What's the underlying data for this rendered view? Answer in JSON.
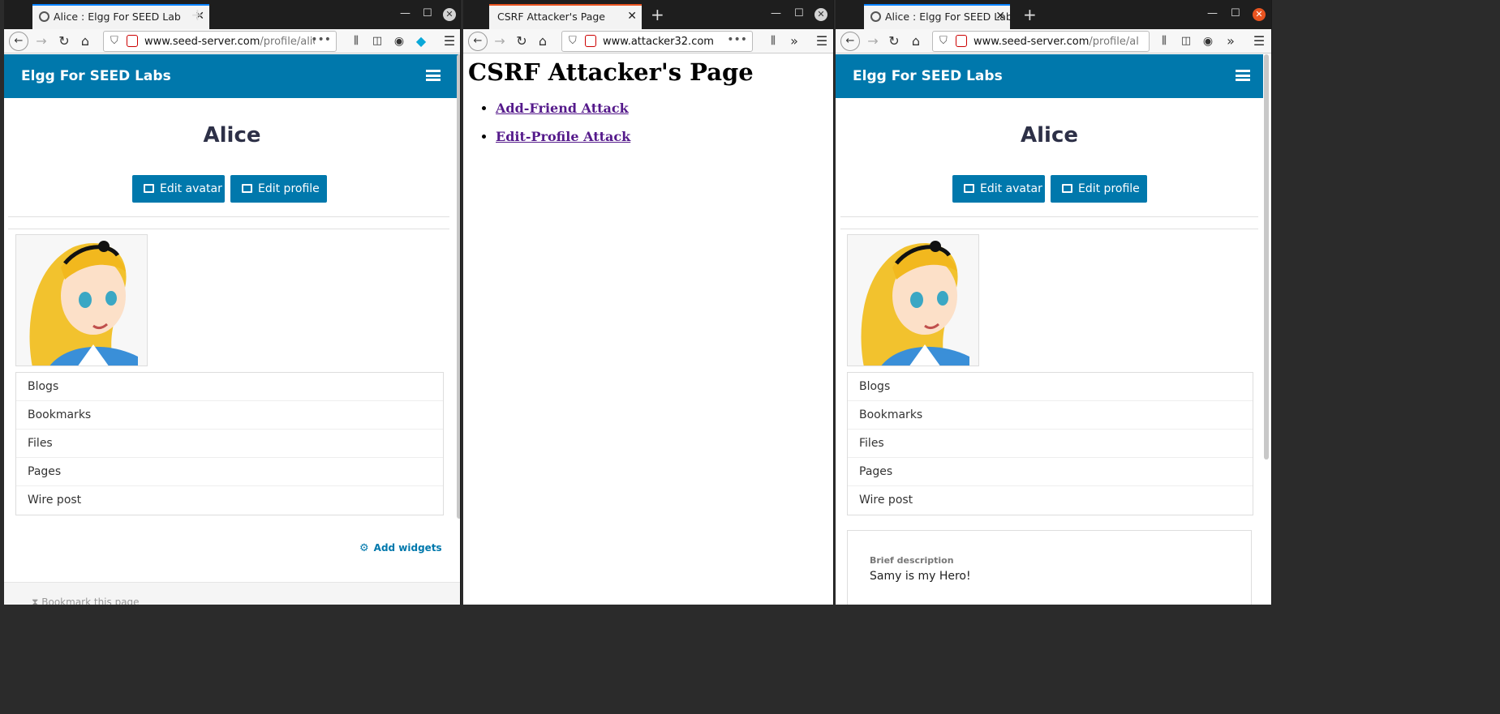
{
  "windows": {
    "left": {
      "tab_title": "Alice : Elgg For SEED Lab",
      "url_host": "www.seed-server.com",
      "url_path": "/profile/alice"
    },
    "middle": {
      "tab_title": "CSRF Attacker's Page",
      "url_host": "www.attacker32.com",
      "url_path": ""
    },
    "right": {
      "tab_title": "Alice : Elgg For SEED Lab",
      "url_host": "www.seed-server.com",
      "url_path": "/profile/al"
    }
  },
  "elgg": {
    "brand": "Elgg For SEED Labs",
    "profile_name": "Alice",
    "edit_avatar": "Edit avatar",
    "edit_profile": "Edit profile",
    "menu": [
      "Blogs",
      "Bookmarks",
      "Files",
      "Pages",
      "Wire post"
    ],
    "add_widgets": "Add widgets",
    "bookmark_page": "Bookmark this page",
    "brief_label": "Brief description",
    "brief_value": "Samy is my Hero!"
  },
  "attacker": {
    "title": "CSRF Attacker's Page",
    "links": [
      "Add-Friend Attack",
      "Edit-Profile Attack"
    ]
  },
  "colors": {
    "elgg_blue": "#0078ac",
    "link_visited": "#551a8b"
  }
}
